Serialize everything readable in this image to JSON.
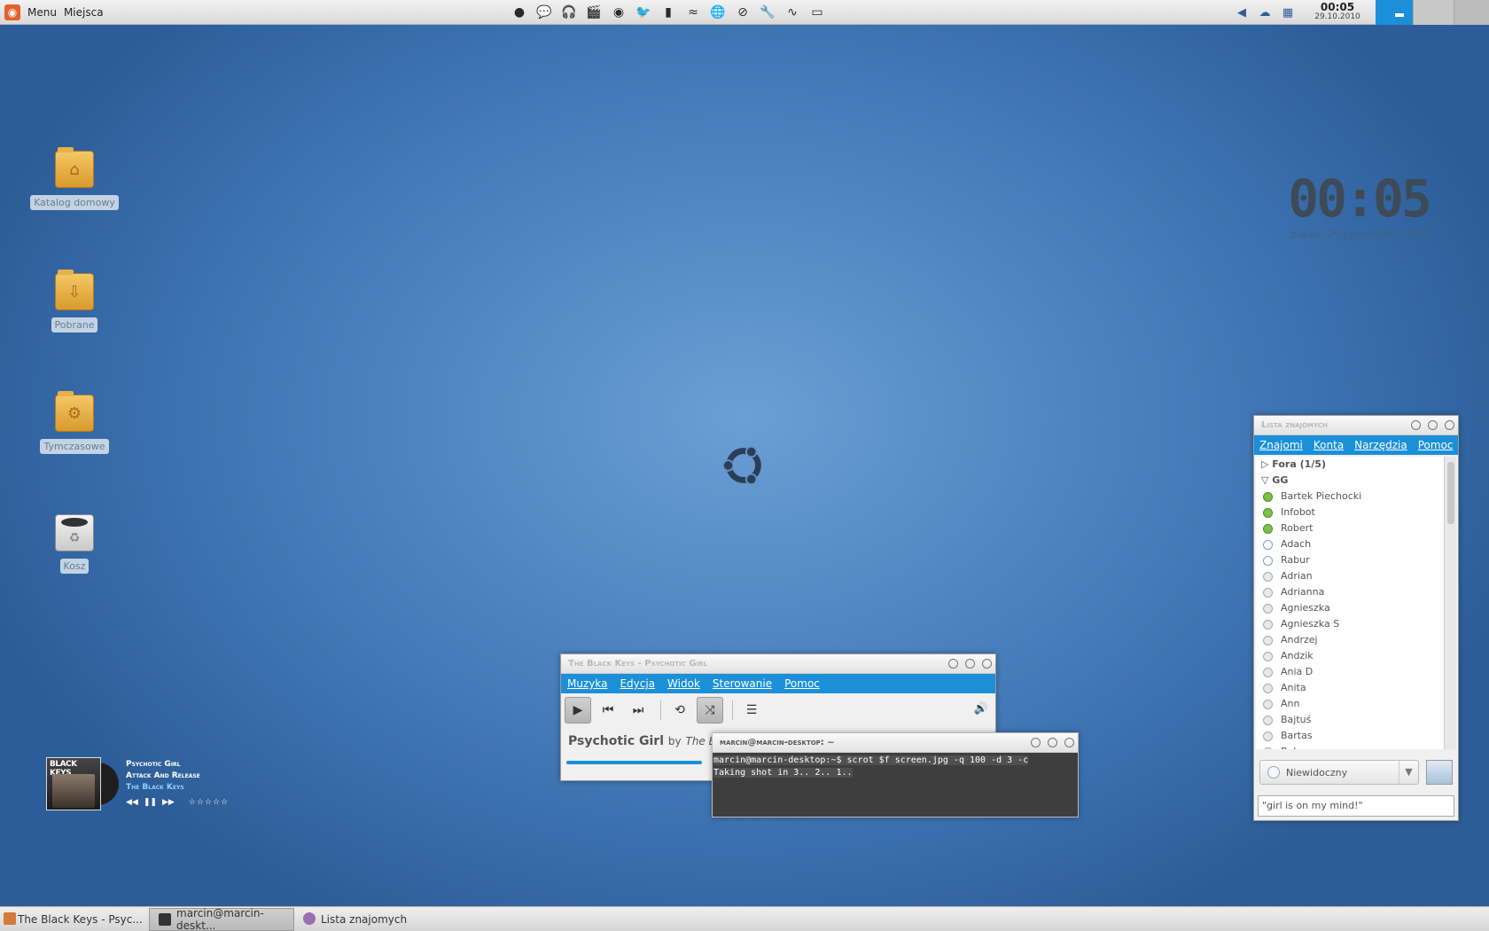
{
  "top_panel": {
    "menu_label": "Menu",
    "places_label": "Miejsca",
    "launchers": [
      "firefox-icon",
      "chat-icon",
      "headphones-icon",
      "film-icon",
      "disc-icon",
      "bird-icon",
      "book-icon",
      "wave-icon",
      "globe-icon",
      "brush-icon",
      "wrench-icon",
      "pulse-icon",
      "monitor-icon"
    ],
    "clock_time": "00:05",
    "clock_date": "29.10.2010"
  },
  "desktop_icons": [
    {
      "label": "Katalog domowy",
      "icon": "home-folder-icon"
    },
    {
      "label": "Pobrane",
      "icon": "downloads-folder-icon"
    },
    {
      "label": "Tymczasowe",
      "icon": "temp-folder-icon"
    },
    {
      "label": "Kosz",
      "icon": "trash-icon"
    }
  ],
  "big_clock": {
    "time": "00:05",
    "date": "piątek, 29 październik 2010"
  },
  "music_widget": {
    "cover_text": "BLACK KEYS",
    "title": "Psychotic Girl",
    "album": "Attack And Release",
    "artist": "The Black Keys",
    "rating_stars": 0
  },
  "rhythmbox": {
    "title": "The Black Keys - Psychotic Girl",
    "menu": [
      "Muzyka",
      "Edycja",
      "Widok",
      "Sterowanie",
      "Pomoc"
    ],
    "song": "Psychotic Girl",
    "by": "by",
    "artist": "The Black",
    "progress": 0.45
  },
  "terminal": {
    "title": "marcin@marcin-desktop: ~",
    "lines": [
      "marcin@marcin-desktop:~$ scrot $f screen.jpg -q 100 -d 3 -c",
      "Taking shot in 3.. 2.. 1.."
    ]
  },
  "buddy_list": {
    "title": "Lista znajomych",
    "menu": [
      "Znajomi",
      "Konta",
      "Narzędzia",
      "Pomoc"
    ],
    "groups": [
      {
        "name": "Fora (1/5)",
        "expanded": false
      },
      {
        "name": "GG",
        "expanded": true
      }
    ],
    "contacts": [
      {
        "name": "Bartek Piechocki",
        "status": "online"
      },
      {
        "name": "Infobot",
        "status": "online"
      },
      {
        "name": "Robert",
        "status": "online"
      },
      {
        "name": "Adach",
        "status": "away"
      },
      {
        "name": "Rabur",
        "status": "away"
      },
      {
        "name": "Adrian",
        "status": "off"
      },
      {
        "name": "Adrianna",
        "status": "off"
      },
      {
        "name": "Agnieszka",
        "status": "off"
      },
      {
        "name": "Agnieszka S",
        "status": "off"
      },
      {
        "name": "Andrzej",
        "status": "off"
      },
      {
        "name": "Andzik",
        "status": "off"
      },
      {
        "name": "Ania D",
        "status": "off"
      },
      {
        "name": "Anita",
        "status": "off"
      },
      {
        "name": "Ann",
        "status": "off"
      },
      {
        "name": "Bajtuś",
        "status": "off"
      },
      {
        "name": "Bartas",
        "status": "off"
      },
      {
        "name": "Bak",
        "status": "off"
      }
    ],
    "status_value": "Niewidoczny",
    "status_message": "\"girl is on my mind!\""
  },
  "taskbar": [
    {
      "label": "The Black Keys - Psyc...",
      "active": false,
      "icon": "rhythmbox-icon"
    },
    {
      "label": "marcin@marcin-deskt...",
      "active": true,
      "icon": "terminal-icon"
    },
    {
      "label": "Lista znajomych",
      "active": false,
      "icon": "pidgin-icon"
    }
  ],
  "colors": {
    "accent": "#1b8fd8",
    "desktop": "#4f86c2"
  }
}
